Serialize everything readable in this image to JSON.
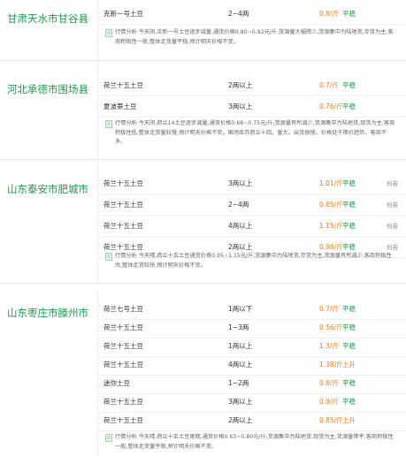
{
  "regions": [
    {
      "name": "甘肃天水市甘谷县",
      "rows": [
        {
          "variety": "克新一号土豆",
          "spec": "2~4两",
          "price": "0.8/斤",
          "trend": "平稳",
          "extra": ""
        }
      ],
      "analysis": "行情分析 今天阴,克新一号土豆逐步减量,通货价格0.80~0.92元/斤,货源量大幅降少,货源集中为陆地货,存货为主,客商积极性一般,整体走货量平稳,预计明天价格不变。"
    },
    {
      "name": "河北承德市围场县",
      "rows": [
        {
          "variety": "荷兰十五土豆",
          "spec": "2两以上",
          "price": "0.7/斤",
          "trend": "平稳",
          "extra": ""
        },
        {
          "variety": "夏波蒂土豆",
          "spec": "3两以上",
          "price": "0.76/斤",
          "trend": "平稳",
          "extra": ""
        }
      ],
      "analysis": "行情分析 今天阴,荷兰14土豆逐步减量,通货价格0.68~0.75元/斤,货源量有所减少,货源集中为陆地货,现货为主,客商积极性低,整体走货量较慢,预计明天价格不变。国场库存荷兰十四。量大。出货很慢。价格处于降价趋势。客商不多。"
    },
    {
      "name": "山东泰安市肥城市",
      "rows": [
        {
          "variety": "荷兰十五土豆",
          "spec": "3两以上",
          "price": "1.01/斤",
          "trend": "平稳",
          "extra": "刹苗"
        },
        {
          "variety": "荷兰十五土豆",
          "spec": "2~4两",
          "price": "0.65/斤",
          "trend": "平稳",
          "extra": "刹苗"
        },
        {
          "variety": "荷兰十五土豆",
          "spec": "4两以上",
          "price": "1.15/斤",
          "trend": "平稳",
          "extra": "刹苗"
        },
        {
          "variety": "荷兰十五土豆",
          "spec": "2两以上",
          "price": "0.96/斤",
          "trend": "平稳",
          "extra": "刹苗"
        }
      ],
      "analysis": "行情分析 今天晴,荷兰十五土豆通货价格0.95~1.15元/斤,货源集中为陆地货,存货为主,货源量有所减少,客商积极性尚,整体走货较快,预计明天价格不变。"
    },
    {
      "name": "山东枣庄市滕州市",
      "rows": [
        {
          "variety": "荷兰七号土豆",
          "spec": "1两以下",
          "price": "0.7/斤",
          "trend": "平稳",
          "extra": ""
        },
        {
          "variety": "荷兰十五土豆",
          "spec": "1~3两",
          "price": "0.56/斤",
          "trend": "平稳",
          "extra": ""
        },
        {
          "variety": "荷兰十五土豆",
          "spec": "1两以上",
          "price": "1.3/斤",
          "trend": "平稳",
          "extra": ""
        },
        {
          "variety": "荷兰十五土豆",
          "spec": "4两以上",
          "price": "1.38/斤",
          "trend": "上升",
          "extra": ""
        },
        {
          "variety": "迷你土豆",
          "spec": "1~2两",
          "price": "0.8/斤",
          "trend": "平稳",
          "extra": ""
        },
        {
          "variety": "荷兰十五土豆",
          "spec": "3两以上",
          "price": "0.9/斤",
          "trend": "平稳",
          "extra": ""
        },
        {
          "variety": "荷兰十五土豆",
          "spec": "2两以上",
          "price": "0.85/斤",
          "trend": "上升",
          "extra": ""
        }
      ],
      "analysis": "行情分析 今天晴,荷兰十五土豆尾期,通货价格0.63~0.80元/斤,货源集中为陆地货,现货为主,货源量降平,客商积极性一般,整体走货量平稳,预计明天价格不变。"
    }
  ],
  "colors": {
    "region_green": "#1d9a4d",
    "price_orange": "#f07b1a",
    "trend_up": "#f07b1a",
    "trend_flat": "#1d9a4d"
  },
  "icons": {
    "analysis": "document-icon"
  }
}
